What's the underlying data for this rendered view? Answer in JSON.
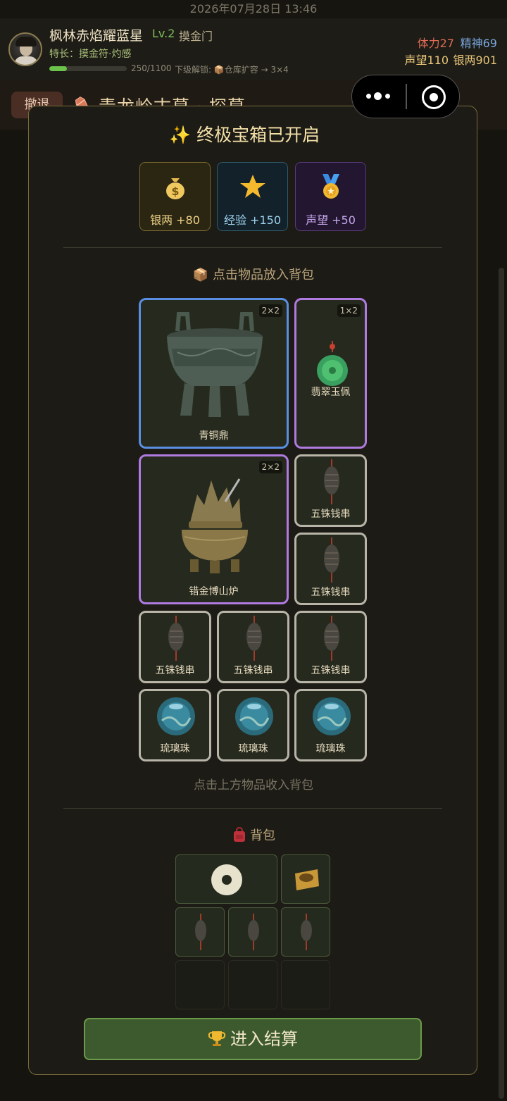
{
  "status": {
    "datetime": "2026年07月28日 13:46"
  },
  "profile": {
    "name": "枫林赤焰耀蓝星",
    "level": "Lv.2",
    "sect": "摸金门",
    "skill": "特长：摸金符·灼感",
    "exp_text": "250/1100",
    "exp_progress": 0.23,
    "unlock": "下级解锁: 📦仓库扩容 → 3×4",
    "stamina": "体力27",
    "spirit": "精神69",
    "reputation": "声望110",
    "silver": "银两901"
  },
  "header": {
    "retreat_label": "撤退",
    "title": "青龙岭古墓 · 探墓"
  },
  "chest": {
    "title": "✨ 终极宝箱已开启",
    "rewards": [
      {
        "icon": "money-bag-icon",
        "label": "银两 +80"
      },
      {
        "icon": "star-icon",
        "label": "经验 +150"
      },
      {
        "icon": "medal-icon",
        "label": "声望 +50"
      }
    ]
  },
  "loot": {
    "section_title": "📦 点击物品放入背包",
    "items": [
      {
        "name": "青铜鼎",
        "size": "2×2"
      },
      {
        "name": "翡翠玉佩",
        "size": "1×2"
      },
      {
        "name": "错金博山炉",
        "size": "2×2"
      },
      {
        "name": "五铢钱串"
      },
      {
        "name": "五铢钱串"
      },
      {
        "name": "五铢钱串"
      },
      {
        "name": "五铢钱串"
      },
      {
        "name": "五铢钱串"
      },
      {
        "name": "琉璃珠"
      },
      {
        "name": "琉璃珠"
      },
      {
        "name": "琉璃珠"
      }
    ],
    "hint": "点击上方物品收入背包"
  },
  "bag": {
    "title": "背包"
  },
  "settle": {
    "label": "进入结算"
  },
  "colors": {
    "accent_gold": "#e9c77a",
    "rare_blue": "#5a8ee0",
    "epic_purple": "#b07ae0",
    "common_white": "#b8b4a8",
    "settle_green": "#3d5a2e"
  }
}
